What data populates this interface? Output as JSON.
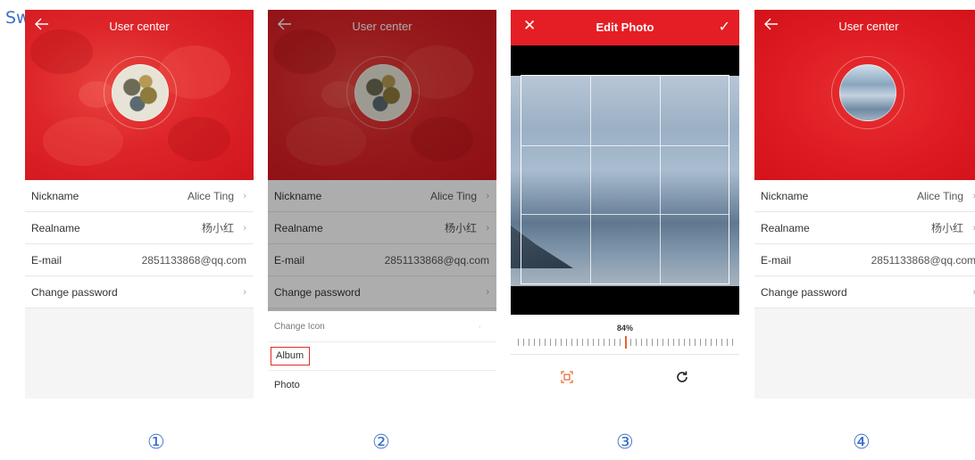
{
  "overlay_caption": "Sw                                                                                 w",
  "step_numbers": [
    "①",
    "②",
    "③",
    "④"
  ],
  "user_center": {
    "title": "User center",
    "rows": [
      {
        "label": "Nickname",
        "value": "Alice Ting"
      },
      {
        "label": "Realname",
        "value": "杨小红"
      },
      {
        "label": "E-mail",
        "value": "2851133868@qq.com"
      },
      {
        "label": "Change password",
        "value": ""
      }
    ]
  },
  "icon_sheet": {
    "title": "Change Icon",
    "album": "Album",
    "photo": "Photo"
  },
  "edit_photo": {
    "title": "Edit Photo",
    "zoom_percent": "84%"
  },
  "colors": {
    "brand_red": "#e51e25",
    "step_blue": "#3b6fc9",
    "ruler_accent": "#e8622a"
  }
}
